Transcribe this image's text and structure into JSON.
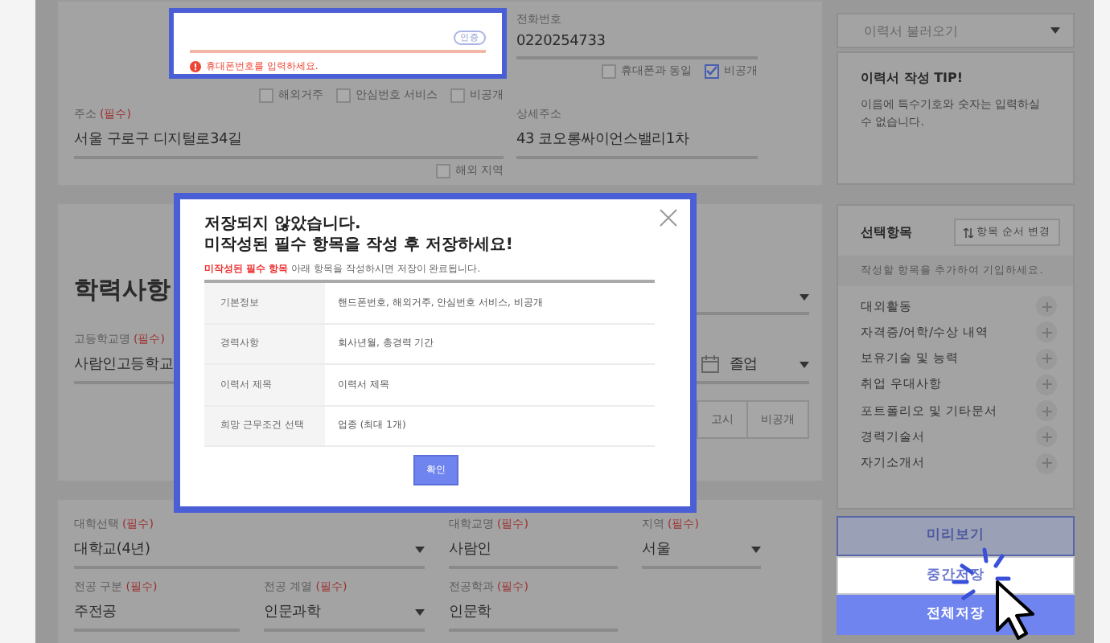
{
  "phone_popup": {
    "button": "인증",
    "error": "휴대폰번호를 입력하세요."
  },
  "contact": {
    "phone": {
      "label": "전화번호",
      "value": "0220254733"
    },
    "phone_options": [
      {
        "label": "휴대폰과 동일",
        "checked": false
      },
      {
        "label": "비공개",
        "checked": true
      }
    ],
    "mobile_options": [
      {
        "label": "해외거주",
        "checked": false
      },
      {
        "label": "안심번호 서비스",
        "checked": false
      },
      {
        "label": "비공개",
        "checked": false
      }
    ]
  },
  "address": {
    "fields": [
      {
        "label": "주소",
        "required_mark": "(필수)",
        "value": "서울 구로구 디지털로34길"
      },
      {
        "label": "상세주소",
        "value": "43 코오롱싸이언스밸리1차"
      }
    ],
    "overseas": {
      "label": "해외 지역",
      "checked": false
    }
  },
  "education": {
    "title": "학력사항",
    "school": {
      "label": "고등학교명",
      "required_mark": "(필수)",
      "value": "사람인고등학교"
    },
    "status": "졸업",
    "buttons": [
      "고시",
      "비공개"
    ]
  },
  "university": {
    "fields": [
      {
        "label": "대학선택",
        "required_mark": "(필수)",
        "value": "대학교(4년)",
        "kind": "select"
      },
      {
        "label": "대학교명",
        "required_mark": "(필수)",
        "value": "사람인",
        "kind": "text"
      },
      {
        "label": "지역",
        "required_mark": "(필수)",
        "value": "서울",
        "kind": "select"
      },
      {
        "label": "전공 구분",
        "required_mark": "(필수)",
        "value": "주전공",
        "kind": "text"
      },
      {
        "label": "전공 계열",
        "required_mark": "(필수)",
        "value": "인문과학",
        "kind": "select"
      },
      {
        "label": "전공학과",
        "required_mark": "(필수)",
        "value": "인문학",
        "kind": "text"
      }
    ]
  },
  "sidebar": {
    "load": "이력서 불러오기",
    "tip": {
      "title": "이력서 작성 TIP!",
      "text": "이름에 특수기호와 숫자는 입력하실 수 없습니다."
    },
    "optional": {
      "title": "선택항목",
      "order_button": "항목 순서 변경",
      "hint": "작성할 항목을 추가하여 기입하세요.",
      "items": [
        "대외활동",
        "자격증/어학/수상 내역",
        "보유기술 및 능력",
        "취업 우대사항",
        "포트폴리오 및 기타문서",
        "경력기술서",
        "자기소개서"
      ]
    },
    "actions": [
      {
        "label": "미리보기",
        "kind": "outline"
      },
      {
        "label": "중간저장",
        "kind": "plain"
      },
      {
        "label": "전체저장",
        "kind": "primary"
      }
    ]
  },
  "modal": {
    "title_lines": [
      "저장되지 않았습니다.",
      "미작성된 필수 항목을 작성 후 저장하세요!"
    ],
    "note_highlight": "미작성된 필수 항목",
    "note": "아래 항목을 작성하시면 저장이 완료됩니다.",
    "rows": [
      {
        "label": "기본정보",
        "value": "핸드폰번호, 해외거주, 안심번호 서비스, 비공개"
      },
      {
        "label": "경력사항",
        "value": "회사년월, 총경력 기간"
      },
      {
        "label": "이력서 제목",
        "value": "이력서 제목"
      },
      {
        "label": "희망 근무조건 선택",
        "value": "업종 (최대 1개)"
      }
    ],
    "button": "확인"
  }
}
